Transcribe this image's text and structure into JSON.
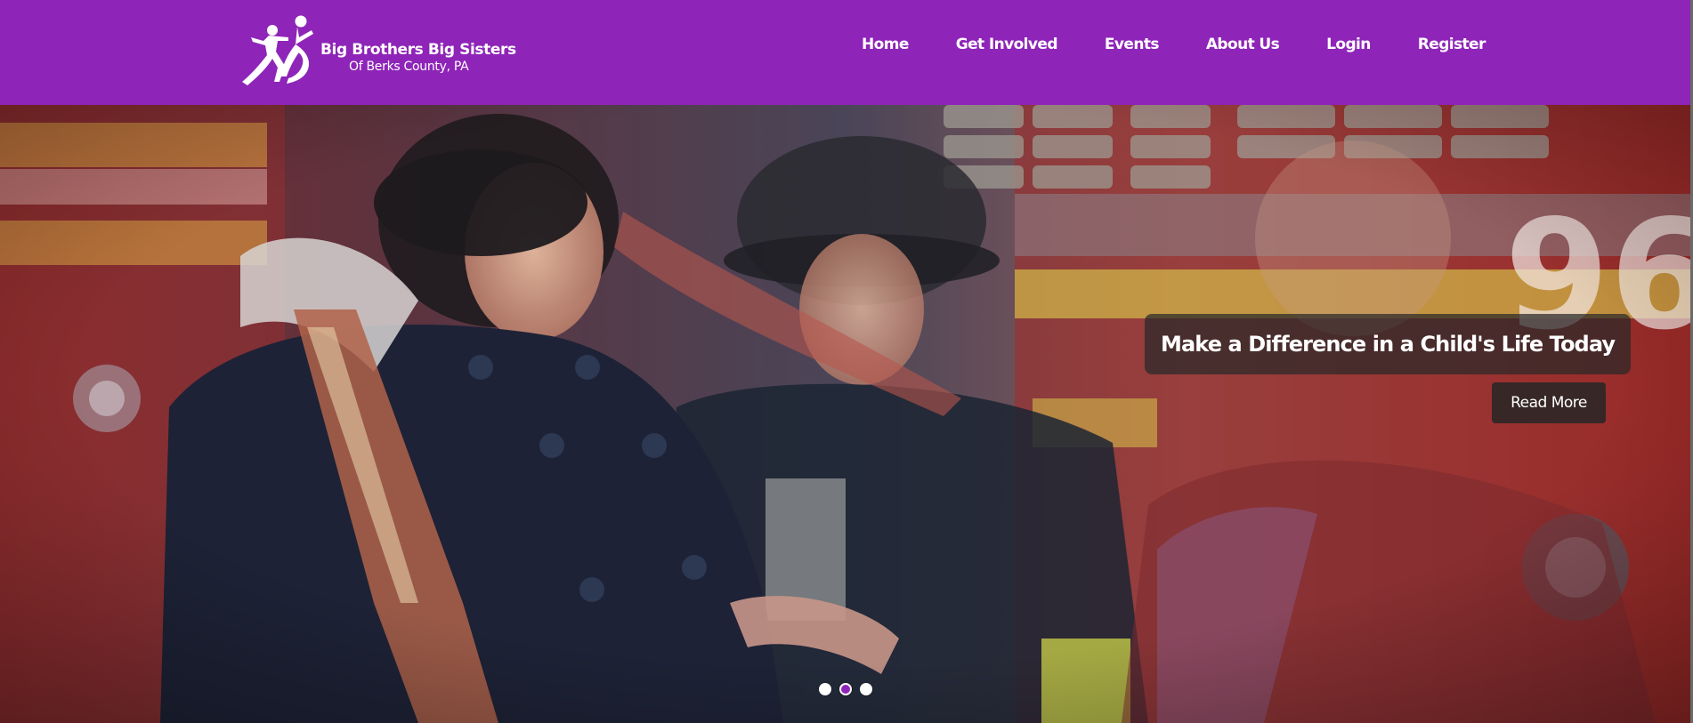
{
  "site": {
    "logo": {
      "line1": "Big Brothers Big Sisters",
      "line2": "Of Berks County, PA",
      "icon": "bbbs-figures-logo-icon"
    },
    "nav": [
      {
        "label": "Home"
      },
      {
        "label": "Get Involved"
      },
      {
        "label": "Events"
      },
      {
        "label": "About Us"
      },
      {
        "label": "Login"
      },
      {
        "label": "Register"
      }
    ]
  },
  "hero": {
    "caption": "Make a Difference in a Child's Life Today",
    "button_label": "Read More",
    "slides_count": 3,
    "active_slide": 2
  },
  "colors": {
    "header_bg": "#8e24b8",
    "accent": "#8e24b8",
    "text_on_dark": "#ffffff"
  }
}
